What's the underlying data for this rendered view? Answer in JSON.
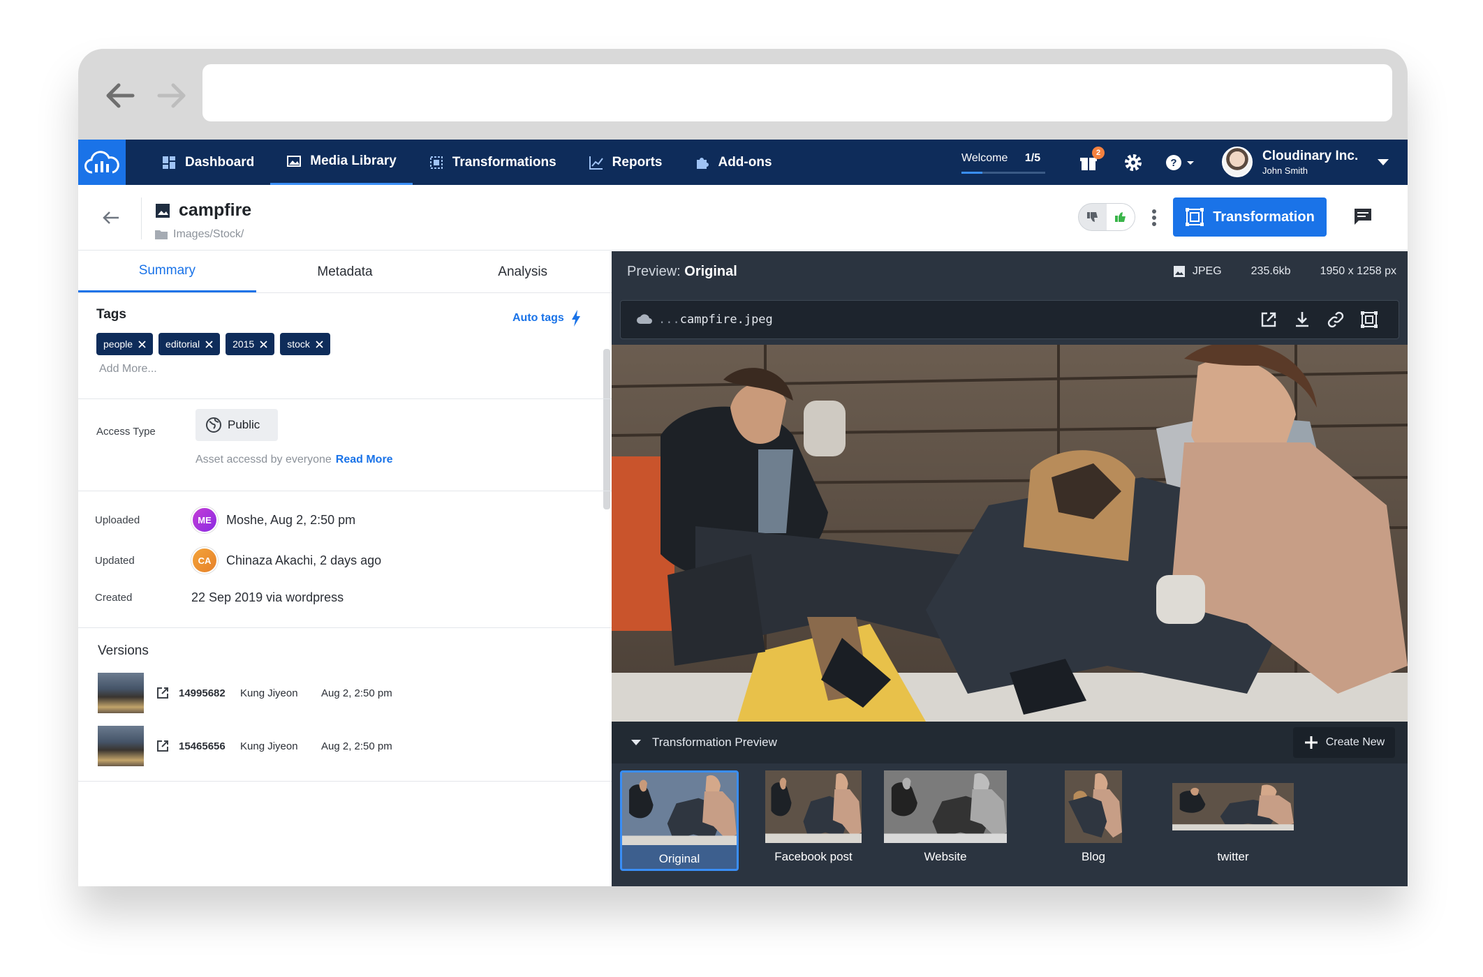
{
  "nav": {
    "items": [
      {
        "label": "Dashboard",
        "icon": "dashboard-icon"
      },
      {
        "label": "Media Library",
        "icon": "image-icon"
      },
      {
        "label": "Transformations",
        "icon": "transform-icon"
      },
      {
        "label": "Reports",
        "icon": "chart-line-icon"
      },
      {
        "label": "Add-ons",
        "icon": "puzzle-icon"
      }
    ],
    "welcome_label": "Welcome",
    "welcome_progress": "1/5",
    "notifications_count": "2",
    "org_name": "Cloudinary Inc.",
    "user_name": "John Smith"
  },
  "asset": {
    "title": "campfire",
    "path": "Images/Stock/",
    "transformation_button": "Transformation"
  },
  "tabs": [
    "Summary",
    "Metadata",
    "Analysis"
  ],
  "tags": {
    "title": "Tags",
    "auto_tags_label": "Auto tags",
    "items": [
      "people",
      "editorial",
      "2015",
      "stock"
    ],
    "add_more": "Add More..."
  },
  "access": {
    "label": "Access Type",
    "value": "Public",
    "note": "Asset accessd by everyone",
    "read_more": "Read More"
  },
  "dates": {
    "uploaded_label": "Uploaded",
    "uploaded_initials": "ME",
    "uploaded_value": "Moshe, Aug 2, 2:50 pm",
    "updated_label": "Updated",
    "updated_initials": "CA",
    "updated_value": "Chinaza Akachi, 2 days ago",
    "created_label": "Created",
    "created_value": "22 Sep 2019 via wordpress"
  },
  "versions": {
    "title": "Versions",
    "items": [
      {
        "id": "14995682",
        "user": "Kung Jiyeon",
        "date": "Aug 2, 2:50 pm"
      },
      {
        "id": "15465656",
        "user": "Kung Jiyeon",
        "date": "Aug 2, 2:50 pm"
      }
    ]
  },
  "preview": {
    "label": "Preview:",
    "mode": "Original",
    "format": "JPEG",
    "size": "235.6kb",
    "dimensions": "1950 x 1258 px",
    "url_prefix": "...",
    "filename": "campfire.jpeg"
  },
  "transformation_preview": {
    "title": "Transformation Preview",
    "create_new": "Create New",
    "items": [
      "Original",
      "Facebook post",
      "Website",
      "Blog",
      "twitter"
    ]
  },
  "colors": {
    "nav_bg": "#0e2c5a",
    "accent": "#1a73e8",
    "panel_dark": "#2b3440"
  }
}
